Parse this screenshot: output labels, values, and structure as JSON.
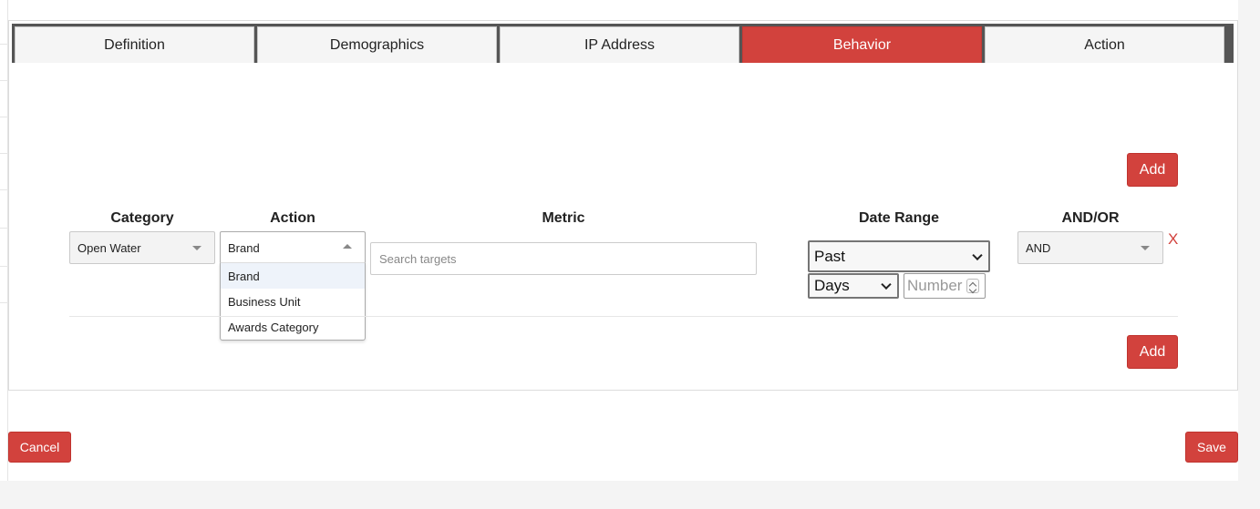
{
  "tabs": [
    {
      "label": "Definition",
      "active": false
    },
    {
      "label": "Demographics",
      "active": false
    },
    {
      "label": "IP Address",
      "active": false
    },
    {
      "label": "Behavior",
      "active": true
    },
    {
      "label": "Action",
      "active": false
    }
  ],
  "colors": {
    "accent": "#d2423d",
    "tabbar": "#555555"
  },
  "buttons": {
    "add_top": "Add",
    "add_bottom": "Add",
    "cancel": "Cancel",
    "save": "Save"
  },
  "columns": {
    "category": "Category",
    "action": "Action",
    "metric": "Metric",
    "date_range": "Date Range",
    "and_or": "AND/OR"
  },
  "row": {
    "category_value": "Open Water",
    "action_value": "Brand",
    "action_options": [
      "Brand",
      "Business Unit",
      "Awards Category"
    ],
    "action_highlighted": "Brand",
    "metric_placeholder": "Search targets",
    "date_range_value": "Past",
    "unit_value": "Days",
    "number_placeholder": "Number",
    "andor_value": "AND",
    "remove_label": "X"
  },
  "icons": {
    "select_caret": "caret-down-icon",
    "select_caret_open": "caret-up-icon",
    "native_chevron": "chevron-down-icon",
    "spinner": "spinner-arrows-icon"
  }
}
